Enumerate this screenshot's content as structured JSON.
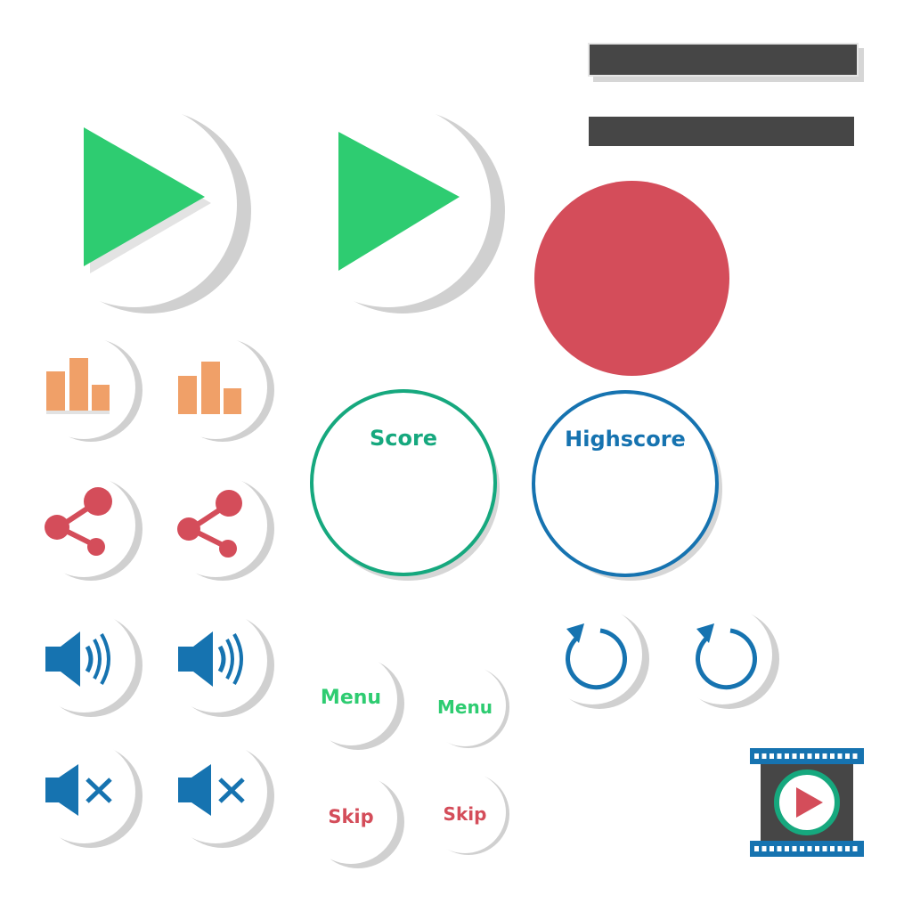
{
  "colors": {
    "green": "#2ecc71",
    "teal": "#16a87e",
    "orange": "#f0a068",
    "red": "#d44d5a",
    "blue": "#1673b0",
    "bar": "#464646",
    "face": "#ffffff",
    "shadow": "#d0d0d0",
    "film": "#1673b0",
    "film_panel": "#464646"
  },
  "score": {
    "label": "Score"
  },
  "highscore": {
    "label": "Highscore"
  },
  "menu_buttons": [
    {
      "label": "Menu"
    },
    {
      "label": "Menu"
    }
  ],
  "skip_buttons": [
    {
      "label": "Skip"
    },
    {
      "label": "Skip"
    }
  ],
  "icons": {
    "play": "play-icon",
    "chart": "bar-chart-icon",
    "share": "share-icon",
    "sound_on": "volume-icon",
    "sound_off": "mute-icon",
    "replay": "replay-icon",
    "video": "video-play-icon"
  }
}
